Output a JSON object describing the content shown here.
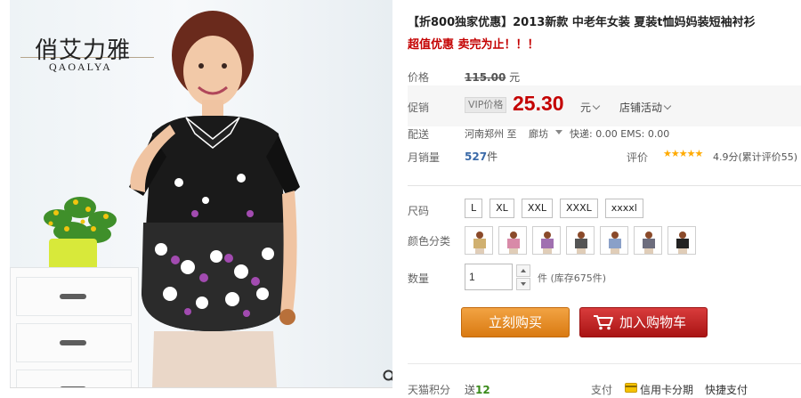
{
  "brand": {
    "name_cn": "俏艾力雅",
    "name_en": "QAOALYA"
  },
  "product": {
    "title_tag": "【折800独家优惠】",
    "title_text": "2013新款 中老年女装 夏装t恤妈妈装短袖衬衫",
    "promo_line": "超值优惠 卖完为止！！！"
  },
  "price": {
    "label": "价格",
    "original": "115.00",
    "unit": "元"
  },
  "promo": {
    "label": "促销",
    "vip_tag": "VIP价格",
    "sale_price": "25.30",
    "unit": "元",
    "store_event": "店铺活动"
  },
  "shipping": {
    "label": "配送",
    "from": "河南郑州",
    "to_word": "至",
    "to_city": "廊坊",
    "fee_text": "快递: 0.00 EMS: 0.00"
  },
  "sales": {
    "label": "月销量",
    "count": "527",
    "count_unit": "件",
    "rating_label": "评价",
    "stars": "★★★★★",
    "rating_text": "4.9分(累计评价55)"
  },
  "size": {
    "label": "尺码",
    "options": [
      "L",
      "XL",
      "XXL",
      "XXXL",
      "xxxxl"
    ]
  },
  "color": {
    "label": "颜色分类",
    "swatch_count_note": ""
  },
  "quantity": {
    "label": "数量",
    "value": "1",
    "stock_text": "件 (库存675件)"
  },
  "actions": {
    "buy_now": "立刻购买",
    "add_to_cart": "加入购物车"
  },
  "footer": {
    "tmall_label": "天猫积分",
    "tmall_prefix": "送",
    "tmall_points": "12",
    "pay_label": "支付",
    "card_pay": "信用卡分期",
    "quick_pay": "快捷支付"
  },
  "colors": {
    "accent_red": "#c40000",
    "buy_orange": "#e38a22",
    "cart_red": "#bf2020",
    "star": "#ffaa00"
  }
}
